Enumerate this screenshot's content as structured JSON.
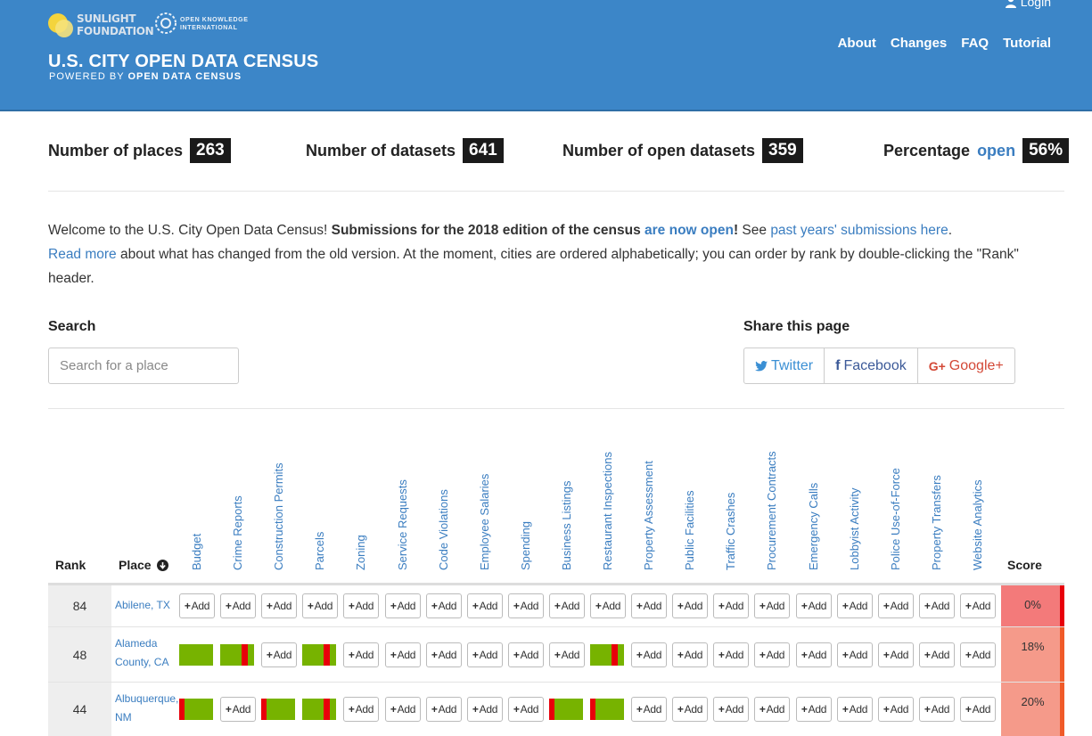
{
  "header": {
    "sunlight_line1": "SUNLIGHT",
    "sunlight_line2": "FOUNDATION",
    "okf_line1": "OPEN KNOWLEDGE",
    "okf_line2": "INTERNATIONAL",
    "title": "U.S. CITY OPEN DATA CENSUS",
    "subtitle_prefix": "POWERED BY ",
    "subtitle_bold": "OPEN DATA CENSUS",
    "login": "Login",
    "nav": [
      "About",
      "Changes",
      "FAQ",
      "Tutorial"
    ]
  },
  "stats": {
    "places_label": "Number of places",
    "places": "263",
    "datasets_label": "Number of datasets",
    "datasets": "641",
    "open_label": "Number of open datasets",
    "open": "359",
    "pct_label": "Percentage",
    "pct_open_word": "open",
    "pct": "56%"
  },
  "welcome": {
    "p1": "Welcome to the U.S. City Open Data Census! ",
    "p1_bold": "Submissions for the 2018 edition of the census ",
    "p1_link": "are now open",
    "p1_bang": "!",
    "p1_see": " See ",
    "p1_link2": "past years' submissions here",
    "p1_end": ".",
    "p2_link": "Read more",
    "p2": " about what has changed from the old version. At the moment, cities are ordered alphabetically; you can order by rank by double-clicking the \"Rank\" header."
  },
  "search": {
    "label": "Search",
    "placeholder": "Search for a place"
  },
  "share": {
    "label": "Share this page",
    "twitter": "Twitter",
    "facebook": "Facebook",
    "google": "Google+"
  },
  "table": {
    "rank_header": "Rank",
    "place_header": "Place",
    "score_header": "Score",
    "add_label": "Add",
    "columns": [
      "Budget",
      "Crime Reports",
      "Construction Permits",
      "Parcels",
      "Zoning",
      "Service Requests",
      "Code Violations",
      "Employee Salaries",
      "Spending",
      "Business Listings",
      "Restaurant Inspections",
      "Property Assessment",
      "Public Facilities",
      "Traffic Crashes",
      "Procurement Contracts",
      "Emergency Calls",
      "Lobbyist Activity",
      "Police Use-of-Force",
      "Property Transfers",
      "Website Analytics"
    ],
    "rows": [
      {
        "rank": "84",
        "place": "Abilene, TX",
        "score": "0%",
        "score_color": "#f37a7a",
        "cells": [
          "add",
          "add",
          "add",
          "add",
          "add",
          "add",
          "add",
          "add",
          "add",
          "add",
          "add",
          "add",
          "add",
          "add",
          "add",
          "add",
          "add",
          "add",
          "add",
          "add"
        ]
      },
      {
        "rank": "48",
        "place_line1": "Alameda",
        "place_line2": "County, CA",
        "score": "18%",
        "score_color": "#f59a8a",
        "cells": [
          "bar0",
          "bar-mid",
          "add",
          "bar-mid",
          "add",
          "add",
          "add",
          "add",
          "add",
          "add",
          "bar-mid",
          "add",
          "add",
          "add",
          "add",
          "add",
          "add",
          "add",
          "add",
          "add"
        ]
      },
      {
        "rank": "44",
        "place_line1": "Albuquerque,",
        "place_line2": "NM",
        "score": "20%",
        "score_color": "#f59a8a",
        "cells": [
          "bar-left",
          "add",
          "bar-left",
          "bar-mid",
          "add",
          "add",
          "add",
          "add",
          "add",
          "bar-left",
          "bar-left",
          "add",
          "add",
          "add",
          "add",
          "add",
          "add",
          "add",
          "add",
          "add"
        ]
      }
    ]
  }
}
